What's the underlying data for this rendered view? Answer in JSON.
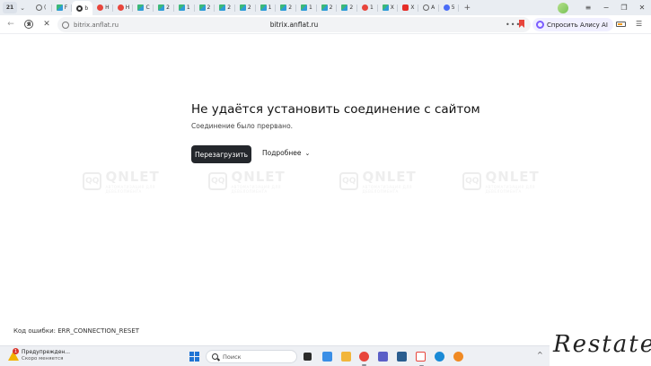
{
  "tabstrip": {
    "tab_count": "21",
    "tabs": [
      {
        "icon": "globe-icon",
        "label": "("
      },
      {
        "icon": "green-square-icon",
        "label": "F"
      },
      {
        "icon": "loading-ring-icon",
        "label": "b",
        "active": true
      },
      {
        "icon": "red-circle-icon",
        "label": "H"
      },
      {
        "icon": "red-circle-icon",
        "label": "H"
      },
      {
        "icon": "green-square-icon",
        "label": "C"
      },
      {
        "icon": "green-square-icon",
        "label": "2"
      },
      {
        "icon": "green-square-icon",
        "label": "1"
      },
      {
        "icon": "green-square-icon",
        "label": "2"
      },
      {
        "icon": "green-square-icon",
        "label": "2"
      },
      {
        "icon": "green-square-icon",
        "label": "2"
      },
      {
        "icon": "green-square-icon",
        "label": "1"
      },
      {
        "icon": "green-square-icon",
        "label": "2"
      },
      {
        "icon": "green-square-icon",
        "label": "1"
      },
      {
        "icon": "green-square-icon",
        "label": "2"
      },
      {
        "icon": "green-square-icon",
        "label": "2"
      },
      {
        "icon": "red-circle-icon",
        "label": "1"
      },
      {
        "icon": "green-square-icon",
        "label": "X"
      },
      {
        "icon": "youtube-icon",
        "label": "X"
      },
      {
        "icon": "globe-icon",
        "label": "A"
      },
      {
        "icon": "blue-circle-icon",
        "label": "5"
      }
    ],
    "new_tab": "+",
    "window_controls": {
      "menu": "≡",
      "minimize": "−",
      "restore": "❐",
      "close": "✕"
    }
  },
  "navbar": {
    "back": "←",
    "yandex": "Я",
    "stop": "✕",
    "host": "bitrix.anflat.ru",
    "title": "bitrix.anflat.ru",
    "more": "•••",
    "alice_label": "Спросить Алису AI",
    "menu": "☰"
  },
  "error_page": {
    "title": "Не удаётся установить соединение с сайтом",
    "subtitle": "Соединение было прервано.",
    "reload_button": "Перезагрузить",
    "more_button": "Подробнее",
    "chevron": "⌄",
    "error_code": "Код ошибки: ERR_CONNECTION_RESET"
  },
  "watermark": {
    "box": "QQ",
    "text": "QNLET",
    "small": "АВТОМАТИЗАЦИЯ ДЛЯ ДЕВЕЛОПМЕНТА"
  },
  "taskbar": {
    "notification_badge": "1",
    "warning_title": "Предупрежден...",
    "warning_subtitle": "Скоро меняется",
    "search_label": "Поиск",
    "tray_up": "^"
  },
  "corner_watermark": "Restate"
}
